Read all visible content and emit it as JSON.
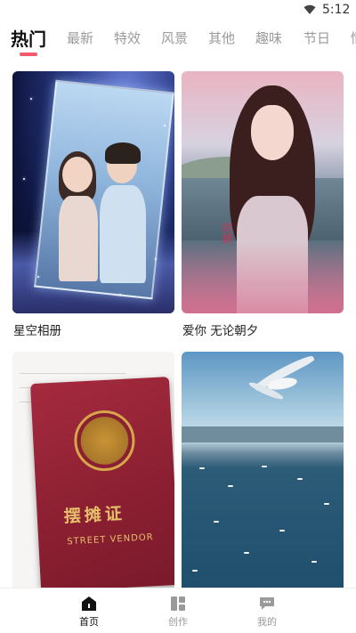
{
  "status_bar": {
    "time": "5:12"
  },
  "tabs": [
    {
      "label": "热门",
      "active": true
    },
    {
      "label": "最新"
    },
    {
      "label": "特效"
    },
    {
      "label": "风景"
    },
    {
      "label": "其他"
    },
    {
      "label": "趣味"
    },
    {
      "label": "节日"
    },
    {
      "label": "情"
    }
  ],
  "grid": [
    {
      "title": "星空相册"
    },
    {
      "title": "爱你 无论朝夕",
      "overlay_text": "同朝"
    },
    {
      "title": "",
      "cover_title": "摆摊证",
      "cover_subtitle": "STREET VENDOR"
    },
    {
      "title": ""
    }
  ],
  "bottom_nav": [
    {
      "label": "首页",
      "icon": "home-icon",
      "active": true
    },
    {
      "label": "创作",
      "icon": "create-icon"
    },
    {
      "label": "我的",
      "icon": "chat-bubble-icon"
    }
  ],
  "colors": {
    "accent": "#f2586a",
    "inactive": "#9a9a9a"
  }
}
